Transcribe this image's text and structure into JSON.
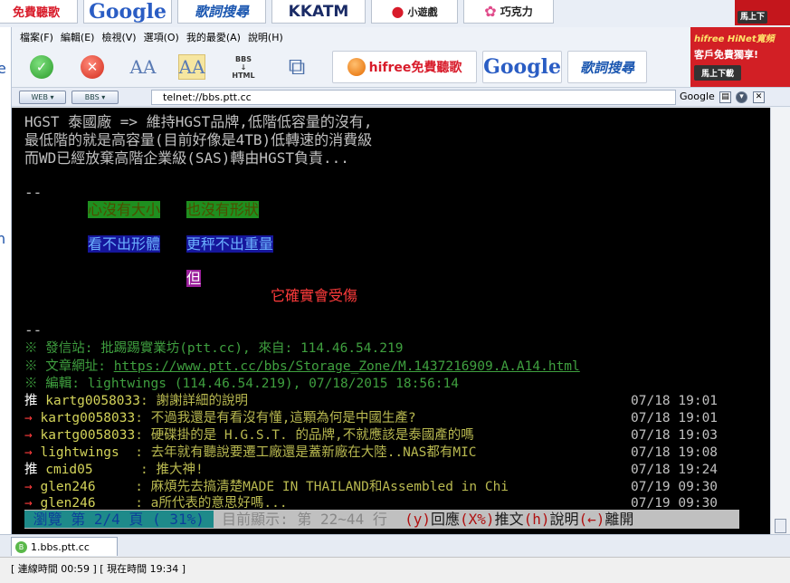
{
  "strip": {
    "hifree": "免費聽歌",
    "google": "Google",
    "lyric": "歌詞搜尋",
    "kkatm": "KKATM",
    "game": "小遊戲",
    "choco": "巧克力",
    "ad_action": "馬上下"
  },
  "menu": [
    "檔案(F)",
    "編輯(E)",
    "檢視(V)",
    "選項(O)",
    "我的最愛(A)",
    "說明(H)"
  ],
  "toolbar": {
    "go": "✓",
    "stop": "✕",
    "font_small": "AA",
    "font_fit": "AA",
    "bbs_html_top": "BBS",
    "bbs_html_bottom": "HTML",
    "hifree": "hifree免費聽歌",
    "google": "Google",
    "lyric": "歌詞搜尋"
  },
  "ad": {
    "line1": "hifree HiNet寬頻",
    "line2": "客戶免費獨享!",
    "line3": "馬上下載"
  },
  "address": {
    "web_dd": "WEB ▾",
    "bbs_dd": "BBS ▾",
    "url": "telnet://bbs.ptt.cc",
    "google": "Google"
  },
  "term": {
    "lines": [
      "HGST 泰國廠 => 維持HGST品牌,低階低容量的沒有,",
      "最低階的就是高容量(目前好像是4TB)低轉速的消費級",
      "而WD已經放棄高階企業級(SAS)轉由HGST負責..."
    ],
    "dash1": "--",
    "sig_a1": "心沒有大小",
    "sig_a2": "也沒有形狀",
    "sig_b1": "看不出形體",
    "sig_b2": "更秤不出重量",
    "sig_c": "但",
    "sig_d": "它確實會受傷",
    "dash2": "--",
    "from": "※ 發信站: 批踢踢實業坊(ptt.cc), 來自: 114.46.54.219",
    "url_prefix": "※ 文章網址: ",
    "url": "https://www.ptt.cc/bbs/Storage_Zone/M.1437216909.A.A14.html",
    "edit": "※ 編輯: lightwings (114.46.54.219), 07/18/2015 18:56:14",
    "pushes": [
      {
        "tag": "推",
        "user": "kartg0058033",
        "text": ": 謝謝詳細的說明",
        "time": "07/18 19:01"
      },
      {
        "tag": "→",
        "user": "kartg0058033",
        "text": ": 不過我還是有看沒有懂,這顆為何是中國生產?",
        "time": "07/18 19:01"
      },
      {
        "tag": "→",
        "user": "kartg0058033",
        "text": ": 硬碟掛的是 H.G.S.T. 的品牌,不就應該是泰國產的嗎",
        "time": "07/18 19:03"
      },
      {
        "tag": "→",
        "user": "lightwings",
        "text": "  : 去年就有聽說要遷工廠還是蓋新廠在大陸..NAS都有MIC",
        "time": "07/18 19:08"
      },
      {
        "tag": "推",
        "user": "cmid05",
        "text": "      : 推大神!",
        "time": "07/18 19:24"
      },
      {
        "tag": "→",
        "user": "glen246",
        "text": "     : 麻煩先去搞清楚MADE IN THAILAND和Assembled in Chi",
        "time": "07/19 09:30"
      },
      {
        "tag": "→",
        "user": "glen246",
        "text": "     : a所代表的意思好嗎...",
        "time": "07/19 09:30"
      }
    ],
    "status": {
      "browse": " 瀏覽 第 2/4 頁 ( 31%) ",
      "showing": " 目前顯示: 第 22~44 行  ",
      "k1": "(y)",
      "t1": "回應",
      "k2": "(X%)",
      "t2": "推文",
      "k3": "(h)",
      "t3": "說明",
      "k4": "(←)",
      "t4": "離開"
    }
  },
  "tab": {
    "label": "1.bbs.ptt.cc",
    "icon": "B"
  },
  "statusbar": {
    "connected": "[ 連線時間 00:59 ]",
    "now": "[ 現在時間 19:34 ]"
  },
  "colors": {
    "terminal_bg": "#000000",
    "terminal_fg": "#c0c0c0",
    "push_tag": "#ffffff",
    "arrow_tag": "#ff3b3b",
    "user": "#d4d45a",
    "signature": "#3fa03f"
  }
}
